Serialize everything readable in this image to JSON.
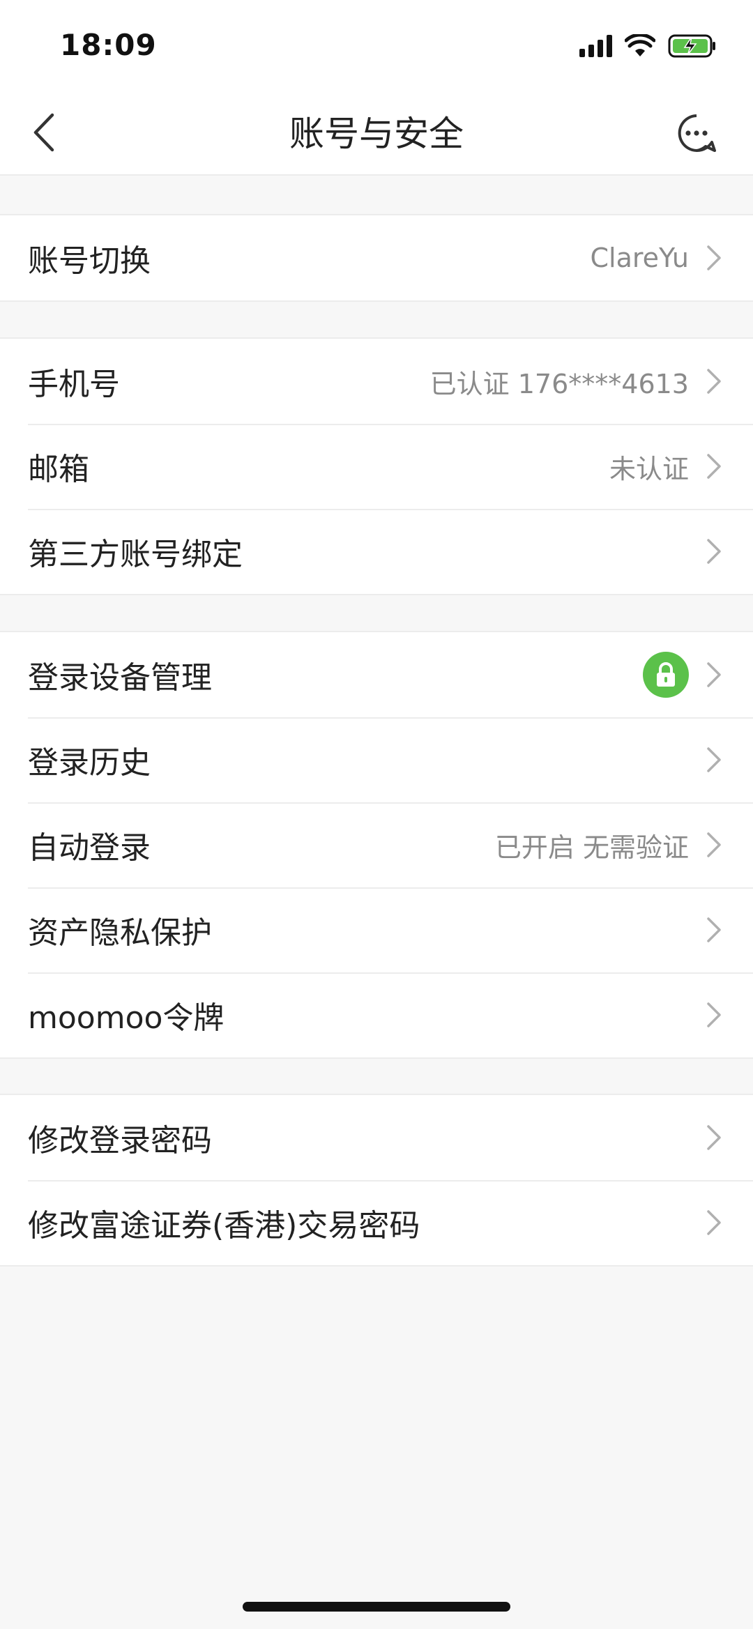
{
  "status_bar": {
    "time": "18:09"
  },
  "nav": {
    "title": "账号与安全"
  },
  "groups": [
    {
      "rows": [
        {
          "label": "账号切换",
          "value": "ClareYu"
        }
      ]
    },
    {
      "rows": [
        {
          "label": "手机号",
          "value": "已认证 176****4613"
        },
        {
          "label": "邮箱",
          "value": "未认证"
        },
        {
          "label": "第三方账号绑定",
          "value": ""
        }
      ]
    },
    {
      "rows": [
        {
          "label": "登录设备管理",
          "value": "",
          "badge": "lock-icon"
        },
        {
          "label": "登录历史",
          "value": ""
        },
        {
          "label": "自动登录",
          "value": "已开启 无需验证"
        },
        {
          "label": "资产隐私保护",
          "value": ""
        },
        {
          "label": "moomoo令牌",
          "value": ""
        }
      ]
    },
    {
      "rows": [
        {
          "label": "修改登录密码",
          "value": ""
        },
        {
          "label": "修改富途证券(香港)交易密码",
          "value": ""
        }
      ]
    }
  ],
  "colors": {
    "lock_badge": "#5bc14a",
    "background": "#f7f7f7",
    "secondary_text": "#8a8a8a",
    "battery_fill": "#5bc14a"
  }
}
